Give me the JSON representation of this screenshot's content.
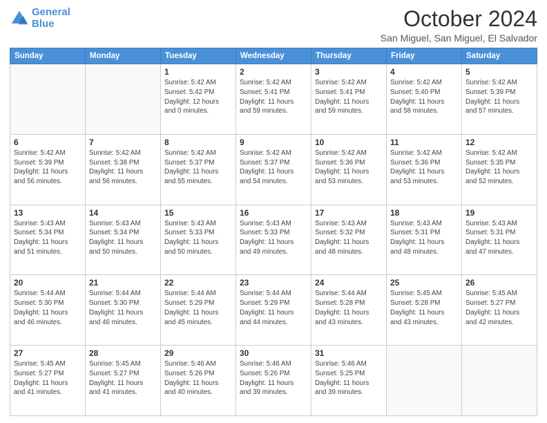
{
  "logo": {
    "line1": "General",
    "line2": "Blue"
  },
  "title": "October 2024",
  "subtitle": "San Miguel, San Miguel, El Salvador",
  "weekdays": [
    "Sunday",
    "Monday",
    "Tuesday",
    "Wednesday",
    "Thursday",
    "Friday",
    "Saturday"
  ],
  "weeks": [
    [
      {
        "day": "",
        "details": ""
      },
      {
        "day": "",
        "details": ""
      },
      {
        "day": "1",
        "details": "Sunrise: 5:42 AM\nSunset: 5:42 PM\nDaylight: 12 hours\nand 0 minutes."
      },
      {
        "day": "2",
        "details": "Sunrise: 5:42 AM\nSunset: 5:41 PM\nDaylight: 11 hours\nand 59 minutes."
      },
      {
        "day": "3",
        "details": "Sunrise: 5:42 AM\nSunset: 5:41 PM\nDaylight: 11 hours\nand 59 minutes."
      },
      {
        "day": "4",
        "details": "Sunrise: 5:42 AM\nSunset: 5:40 PM\nDaylight: 11 hours\nand 58 minutes."
      },
      {
        "day": "5",
        "details": "Sunrise: 5:42 AM\nSunset: 5:39 PM\nDaylight: 11 hours\nand 57 minutes."
      }
    ],
    [
      {
        "day": "6",
        "details": "Sunrise: 5:42 AM\nSunset: 5:39 PM\nDaylight: 11 hours\nand 56 minutes."
      },
      {
        "day": "7",
        "details": "Sunrise: 5:42 AM\nSunset: 5:38 PM\nDaylight: 11 hours\nand 56 minutes."
      },
      {
        "day": "8",
        "details": "Sunrise: 5:42 AM\nSunset: 5:37 PM\nDaylight: 11 hours\nand 55 minutes."
      },
      {
        "day": "9",
        "details": "Sunrise: 5:42 AM\nSunset: 5:37 PM\nDaylight: 11 hours\nand 54 minutes."
      },
      {
        "day": "10",
        "details": "Sunrise: 5:42 AM\nSunset: 5:36 PM\nDaylight: 11 hours\nand 53 minutes."
      },
      {
        "day": "11",
        "details": "Sunrise: 5:42 AM\nSunset: 5:36 PM\nDaylight: 11 hours\nand 53 minutes."
      },
      {
        "day": "12",
        "details": "Sunrise: 5:42 AM\nSunset: 5:35 PM\nDaylight: 11 hours\nand 52 minutes."
      }
    ],
    [
      {
        "day": "13",
        "details": "Sunrise: 5:43 AM\nSunset: 5:34 PM\nDaylight: 11 hours\nand 51 minutes."
      },
      {
        "day": "14",
        "details": "Sunrise: 5:43 AM\nSunset: 5:34 PM\nDaylight: 11 hours\nand 50 minutes."
      },
      {
        "day": "15",
        "details": "Sunrise: 5:43 AM\nSunset: 5:33 PM\nDaylight: 11 hours\nand 50 minutes."
      },
      {
        "day": "16",
        "details": "Sunrise: 5:43 AM\nSunset: 5:33 PM\nDaylight: 11 hours\nand 49 minutes."
      },
      {
        "day": "17",
        "details": "Sunrise: 5:43 AM\nSunset: 5:32 PM\nDaylight: 11 hours\nand 48 minutes."
      },
      {
        "day": "18",
        "details": "Sunrise: 5:43 AM\nSunset: 5:31 PM\nDaylight: 11 hours\nand 48 minutes."
      },
      {
        "day": "19",
        "details": "Sunrise: 5:43 AM\nSunset: 5:31 PM\nDaylight: 11 hours\nand 47 minutes."
      }
    ],
    [
      {
        "day": "20",
        "details": "Sunrise: 5:44 AM\nSunset: 5:30 PM\nDaylight: 11 hours\nand 46 minutes."
      },
      {
        "day": "21",
        "details": "Sunrise: 5:44 AM\nSunset: 5:30 PM\nDaylight: 11 hours\nand 46 minutes."
      },
      {
        "day": "22",
        "details": "Sunrise: 5:44 AM\nSunset: 5:29 PM\nDaylight: 11 hours\nand 45 minutes."
      },
      {
        "day": "23",
        "details": "Sunrise: 5:44 AM\nSunset: 5:29 PM\nDaylight: 11 hours\nand 44 minutes."
      },
      {
        "day": "24",
        "details": "Sunrise: 5:44 AM\nSunset: 5:28 PM\nDaylight: 11 hours\nand 43 minutes."
      },
      {
        "day": "25",
        "details": "Sunrise: 5:45 AM\nSunset: 5:28 PM\nDaylight: 11 hours\nand 43 minutes."
      },
      {
        "day": "26",
        "details": "Sunrise: 5:45 AM\nSunset: 5:27 PM\nDaylight: 11 hours\nand 42 minutes."
      }
    ],
    [
      {
        "day": "27",
        "details": "Sunrise: 5:45 AM\nSunset: 5:27 PM\nDaylight: 11 hours\nand 41 minutes."
      },
      {
        "day": "28",
        "details": "Sunrise: 5:45 AM\nSunset: 5:27 PM\nDaylight: 11 hours\nand 41 minutes."
      },
      {
        "day": "29",
        "details": "Sunrise: 5:46 AM\nSunset: 5:26 PM\nDaylight: 11 hours\nand 40 minutes."
      },
      {
        "day": "30",
        "details": "Sunrise: 5:46 AM\nSunset: 5:26 PM\nDaylight: 11 hours\nand 39 minutes."
      },
      {
        "day": "31",
        "details": "Sunrise: 5:46 AM\nSunset: 5:25 PM\nDaylight: 11 hours\nand 39 minutes."
      },
      {
        "day": "",
        "details": ""
      },
      {
        "day": "",
        "details": ""
      }
    ]
  ]
}
